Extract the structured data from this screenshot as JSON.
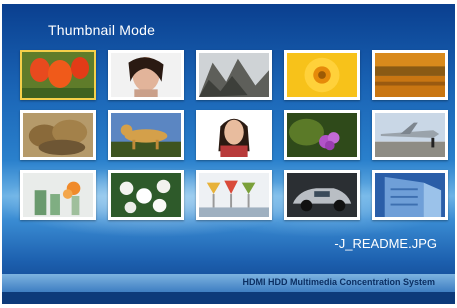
{
  "header": {
    "title": "Thumbnail Mode"
  },
  "thumbnails": [
    {
      "name": "thumb-tulips",
      "subject": "red tulips",
      "selected": true
    },
    {
      "name": "thumb-woman-portrait",
      "subject": "woman portrait"
    },
    {
      "name": "thumb-mountains",
      "subject": "rocky mountains"
    },
    {
      "name": "thumb-sunflower",
      "subject": "yellow flower"
    },
    {
      "name": "thumb-field",
      "subject": "autumn field"
    },
    {
      "name": "thumb-lion-cubs",
      "subject": "lion cubs"
    },
    {
      "name": "thumb-cheetah",
      "subject": "cheetah"
    },
    {
      "name": "thumb-woman-smiling",
      "subject": "smiling woman"
    },
    {
      "name": "thumb-purple-flower",
      "subject": "purple flower"
    },
    {
      "name": "thumb-airplane",
      "subject": "jet airplane"
    },
    {
      "name": "thumb-glasses-flowers",
      "subject": "glasses with flowers"
    },
    {
      "name": "thumb-white-flowers",
      "subject": "white flowers"
    },
    {
      "name": "thumb-cocktails",
      "subject": "cocktail glasses"
    },
    {
      "name": "thumb-car",
      "subject": "silver car"
    },
    {
      "name": "thumb-building",
      "subject": "office building"
    }
  ],
  "status": {
    "filename": "-J_README.JPG"
  },
  "footer": {
    "system_name": "HDMI HDD Multimedia Concentration System"
  }
}
